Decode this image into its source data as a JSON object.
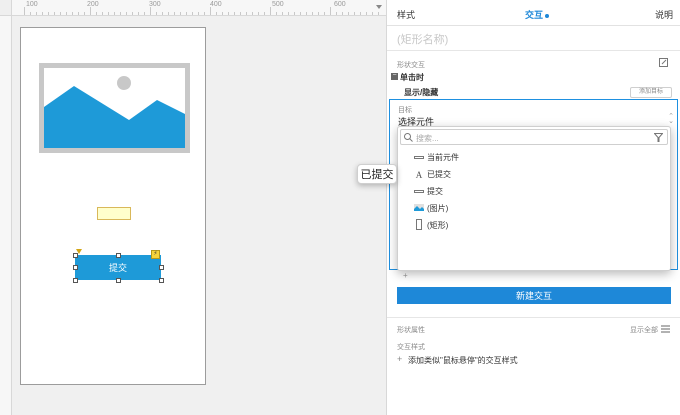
{
  "ruler": {
    "ticks": [
      "100",
      "200",
      "300",
      "400",
      "500",
      "600"
    ]
  },
  "canvas": {
    "button_label": "提交",
    "tooltip": "已提交"
  },
  "panel": {
    "tabs": [
      {
        "label": "样式"
      },
      {
        "label": "交互",
        "active": true
      },
      {
        "label": "说明"
      }
    ],
    "shape_name": "(矩形名称)",
    "interactions_label": "形状交互",
    "event": "单击时",
    "action": "显示/隐藏",
    "add_target": "添加目标",
    "target_label": "目标",
    "target_value": "选择元件",
    "new_interaction": "新建交互",
    "props_label": "形状属性",
    "show_all": "显示全部",
    "interactive_styles_label": "交互样式",
    "add_style_link": "添加类似\"鼠标悬停\"的交互样式"
  },
  "dropdown": {
    "search_placeholder": "搜索...",
    "items": [
      {
        "label": "当前元件",
        "icon": "line-icon"
      },
      {
        "label": "已提交",
        "icon": "text-a-icon"
      },
      {
        "label": "提交",
        "icon": "line-icon"
      },
      {
        "label": "(图片)",
        "icon": "image-icon"
      },
      {
        "label": "(矩形)",
        "icon": "rectangle-icon"
      }
    ]
  },
  "colors": {
    "accent": "#1e88d8",
    "image_fill": "#1e9ad8"
  }
}
